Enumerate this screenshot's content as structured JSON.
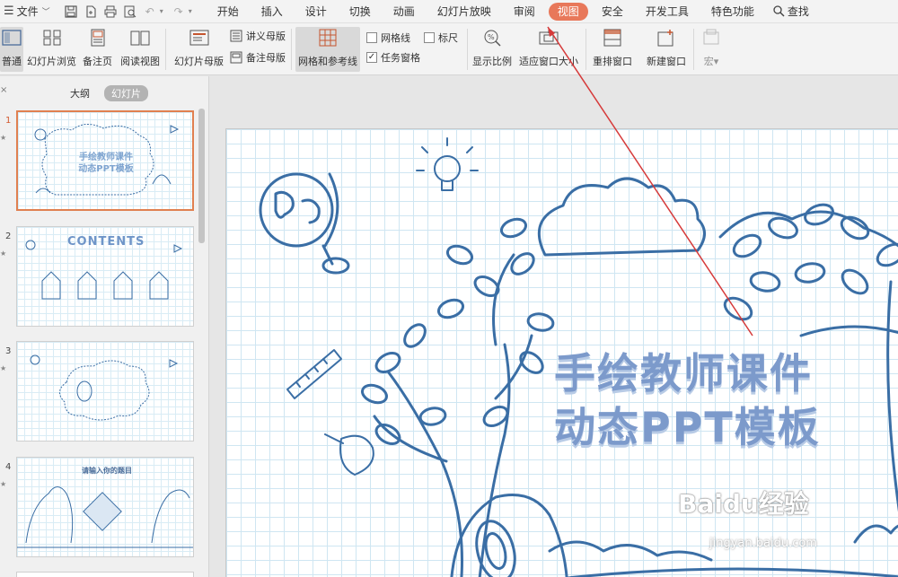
{
  "menubar": {
    "file_label": "文件",
    "tabs": [
      "开始",
      "插入",
      "设计",
      "切换",
      "动画",
      "幻灯片放映",
      "审阅",
      "视图",
      "安全",
      "开发工具",
      "特色功能"
    ],
    "active_tab": "视图",
    "search_label": "查找"
  },
  "ribbon": {
    "normal": "普通",
    "slide_browse": "幻灯片浏览",
    "notes_page": "备注页",
    "reading_view": "阅读视图",
    "slide_master": "幻灯片母版",
    "handout_master": "讲义母版",
    "notes_master": "备注母版",
    "grid_guides": "网格和参考线",
    "gridlines": "网格线",
    "ruler": "标尺",
    "task_pane": "任务窗格",
    "zoom": "显示比例",
    "fit_window": "适应窗口大小",
    "arrange_window": "重排窗口",
    "new_window": "新建窗口",
    "macro": "宏"
  },
  "panel": {
    "tab_outline": "大纲",
    "tab_slides": "幻灯片",
    "slides": [
      {
        "num": "1",
        "title_line1": "手绘教师课件",
        "title_line2": "动态PPT模板"
      },
      {
        "num": "2",
        "title": "CONTENTS"
      },
      {
        "num": "3"
      },
      {
        "num": "4",
        "title": "请输入你的题目"
      }
    ]
  },
  "slide": {
    "title_line1": "手绘教师课件",
    "title_line2": "动态PPT模板"
  },
  "watermark": {
    "brand": "Baidu经验",
    "url": "jingyan.baidu.com"
  },
  "colors": {
    "accent_tab": "#e8785a",
    "doodle_blue": "#3a6ea5",
    "title_blue": "#7c9acb",
    "arrow_red": "#d63a3a"
  }
}
